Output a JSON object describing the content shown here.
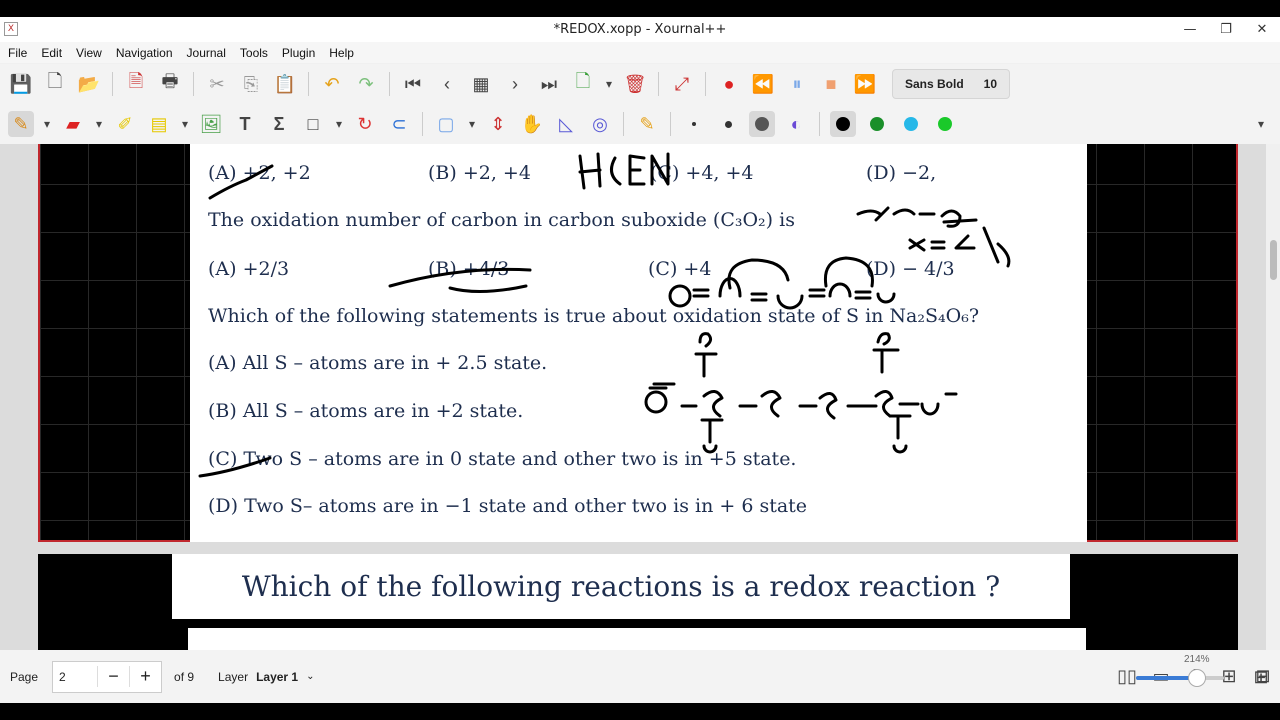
{
  "window": {
    "title": "*REDOX.xopp - Xournal++",
    "app_icon": "xournal-icon"
  },
  "menu": [
    "File",
    "Edit",
    "View",
    "Navigation",
    "Journal",
    "Tools",
    "Plugin",
    "Help"
  ],
  "toolbar": {
    "font_name": "Sans Bold",
    "font_size": "10"
  },
  "colors": {
    "accent": "#c0272d",
    "pen_colors": [
      "#000000",
      "#1a8f2a",
      "#26b8e8",
      "#1ac92a"
    ]
  },
  "document": {
    "lines": [
      "(A) +2, +2",
      "(B) +2, +4",
      "(C) +4, +4",
      "(D) −2,",
      "The oxidation number of carbon in carbon suboxide (C₃O₂) is",
      "(A) +2/3",
      "(B) +4/3",
      "(C) +4",
      "(D) − 4/3",
      "Which of the following statements is true about oxidation state of S in Na₂S₄O₆?",
      "(A) All S – atoms are in + 2.5 state.",
      "(B) All S – atoms are in +2 state.",
      "(C) Two S – atoms are in 0 state and other two is in +5 state.",
      "(D) Two S– atoms are in −1 state and other two is in + 6 state"
    ],
    "handwritten_calc": [
      "3x - 4 = 0",
      "x = 4/3"
    ],
    "banner": "Which of the following reactions is  a redox reaction ?"
  },
  "status": {
    "page_label": "Page",
    "page_value": "2",
    "page_of": "of 9",
    "layer_label": "Layer",
    "layer_value": "Layer 1",
    "zoom": "214%"
  }
}
